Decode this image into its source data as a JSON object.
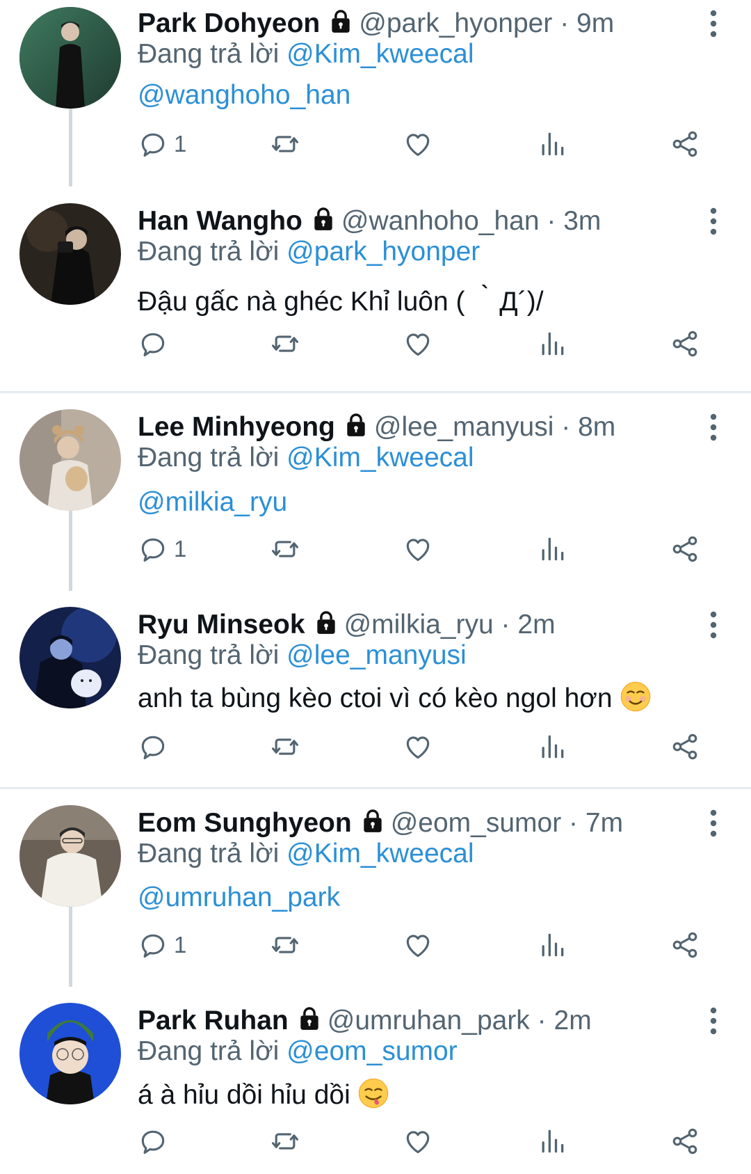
{
  "reply_prefix": "Đang trả lời",
  "colors": {
    "link": "#2b8fd6",
    "muted": "#536471",
    "divider": "#e6ecf0",
    "thread_line": "#cfd9de"
  },
  "tweets": [
    {
      "name": "Park Dohyeon",
      "handle": "@park_hyonper",
      "dot": "·",
      "time": "9m",
      "reply_to": "@Kim_kweecal",
      "text": "@wanghoho_han",
      "reply_count": "1"
    },
    {
      "name": "Han Wangho",
      "handle": "@wanhoho_han",
      "dot": "·",
      "time": "3m",
      "reply_to": "@park_hyonper",
      "text": "Đậu gấc nà ghéc Khỉ luôn ( ｀Д´)/",
      "reply_count": ""
    },
    {
      "name": "Lee Minhyeong",
      "handle": "@lee_manyusi",
      "dot": "·",
      "time": "8m",
      "reply_to": "@Kim_kweecal",
      "text": "@milkia_ryu",
      "reply_count": "1"
    },
    {
      "name": "Ryu Minseok",
      "handle": "@milkia_ryu",
      "dot": "·",
      "time": "2m",
      "reply_to": "@lee_manyusi",
      "text": "anh ta bùng kèo ctoi vì có kèo ngol hơn",
      "emoji": "smiling-face",
      "reply_count": ""
    },
    {
      "name": "Eom Sunghyeon",
      "handle": "@eom_sumor",
      "dot": "·",
      "time": "7m",
      "reply_to": "@Kim_kweecal",
      "text": "@umruhan_park",
      "reply_count": "1"
    },
    {
      "name": "Park Ruhan",
      "handle": "@umruhan_park",
      "dot": "·",
      "time": "2m",
      "reply_to": "@eom_sumor",
      "text": "á à hỉu dồi hỉu dồi",
      "emoji": "yum-face",
      "reply_count": ""
    }
  ]
}
